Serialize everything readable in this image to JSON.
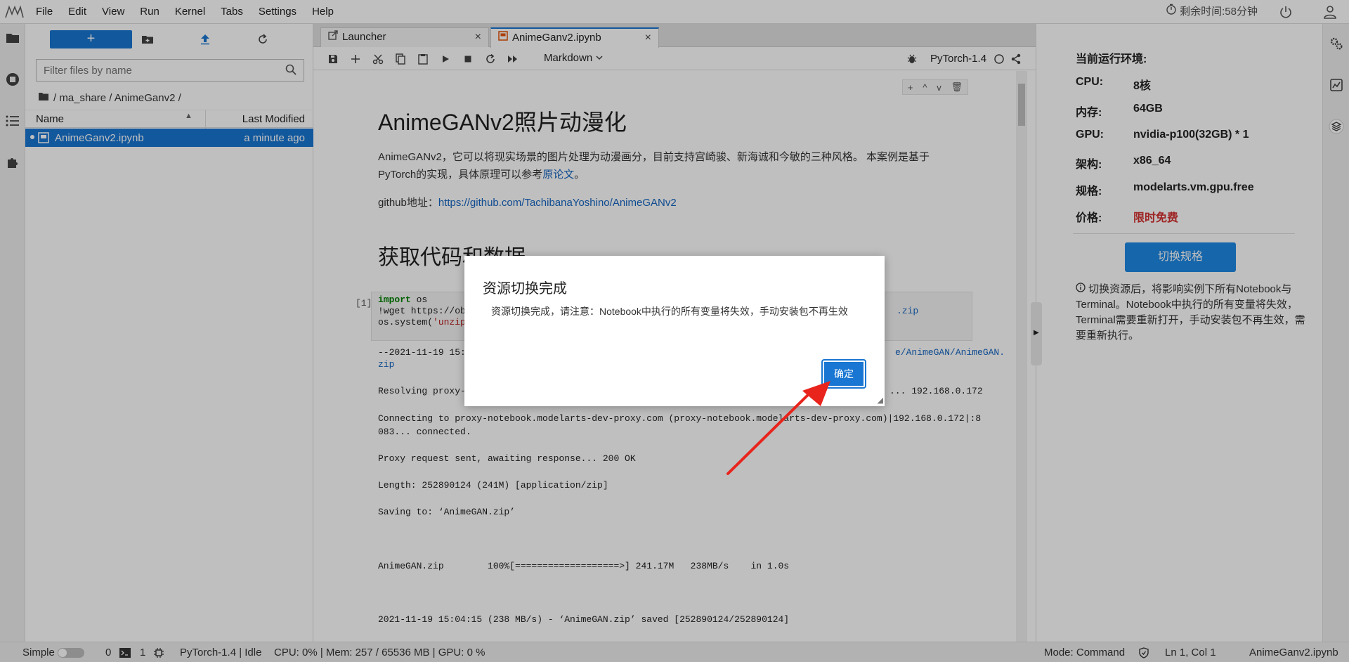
{
  "menubar": {
    "items": [
      "File",
      "Edit",
      "View",
      "Run",
      "Kernel",
      "Tabs",
      "Settings",
      "Help"
    ],
    "timer_text": "剩余时间:58分钟"
  },
  "filebrowser": {
    "new_label": "+",
    "filter_placeholder": "Filter files by name",
    "breadcrumb": "/ ma_share / AnimeGanv2 /",
    "col_name": "Name",
    "col_modified": "Last Modified",
    "files": [
      {
        "name": "AnimeGanv2.ipynb",
        "modified": "a minute ago"
      }
    ]
  },
  "tabs": [
    {
      "label": "Launcher",
      "close": "×"
    },
    {
      "label": "AnimeGanv2.ipynb",
      "close": "×"
    }
  ],
  "nbtoolbar": {
    "cell_type": "Markdown",
    "kernel": "PyTorch-1.4"
  },
  "cell_tools": [
    "+",
    "^",
    "v",
    "🗑"
  ],
  "notebook": {
    "h1": "AnimeGANv2照片动漫化",
    "p1_text": "AnimeGANv2，它可以将现实场景的图片处理为动漫画分，目前支持宫崎骏、新海诚和今敏的三种风格。 本案例是基于PyTorch的实现，具体原理可以参考",
    "p1_link": "原论文",
    "p1_end": "。",
    "p2_label": "github地址：",
    "p2_link": "https://github.com/TachibanaYoshino/AnimeGANv2",
    "h2": "获取代码和数据",
    "prompt": "[1]",
    "code_l1_kw": "import",
    "code_l1_rest": " os",
    "code_l2_a": "!wget https://ob",
    "code_l2_b": ".zip",
    "code_l3_fn": "os.system(",
    "code_l3_str": "'unzip",
    "out_l1_a": "--2021-11-19 15:",
    "out_l1_b": "e/AnimeGAN/AnimeGAN.",
    "out_l2": "zip",
    "out_l3_a": "Resolving proxy-",
    "out_l3_b": "... 192.168.0.172",
    "out_l4": "Connecting to proxy-notebook.modelarts-dev-proxy.com (proxy-notebook.modelarts-dev-proxy.com)|192.168.0.172|:8",
    "out_l5": "083... connected.",
    "out_l6": "Proxy request sent, awaiting response... 200 OK",
    "out_l7": "Length: 252890124 (241M) [application/zip]",
    "out_l8": "Saving to: ‘AnimeGAN.zip’",
    "out_l9": "AnimeGAN.zip        100%[===================>] 241.17M   238MB/s    in 1.0s",
    "out_l10": "2021-11-19 15:04:15 (238 MB/s) - ‘AnimeGAN.zip’ saved [252890124/252890124]"
  },
  "env": {
    "title": "当前运行环境:",
    "rows": [
      {
        "label": "CPU:",
        "value": "8核"
      },
      {
        "label": "内存:",
        "value": "64GB"
      },
      {
        "label": "GPU:",
        "value": "nvidia-p100(32GB) * 1"
      },
      {
        "label": "架构:",
        "value": "x86_64"
      },
      {
        "label": "规格:",
        "value": "modelarts.vm.gpu.free"
      },
      {
        "label": "价格:",
        "value": "限时免费"
      }
    ],
    "switch_label": "切换规格",
    "notice": "切换资源后，将影响实例下所有Notebook与Terminal。Notebook中执行的所有变量将失效，Terminal需要重新打开，手动安装包不再生效，需要重新执行。"
  },
  "statusbar": {
    "mode_simple": "Simple",
    "terminals": "0",
    "kernels": "1",
    "kernel_status": "PyTorch-1.4 | Idle",
    "resources": "CPU: 0% | Mem: 257 / 65536 MB | GPU: 0 %",
    "mode": "Mode: Command",
    "position": "Ln 1, Col 1",
    "filename": "AnimeGanv2.ipynb"
  },
  "dialog": {
    "title": "资源切换完成",
    "body": "资源切换完成，请注意：Notebook中执行的所有变量将失效，手动安装包不再生效",
    "ok_label": "确定"
  },
  "colors": {
    "accent": "#1976d2",
    "price": "#d32f2f",
    "annotation_arrow": "#e8241c"
  }
}
